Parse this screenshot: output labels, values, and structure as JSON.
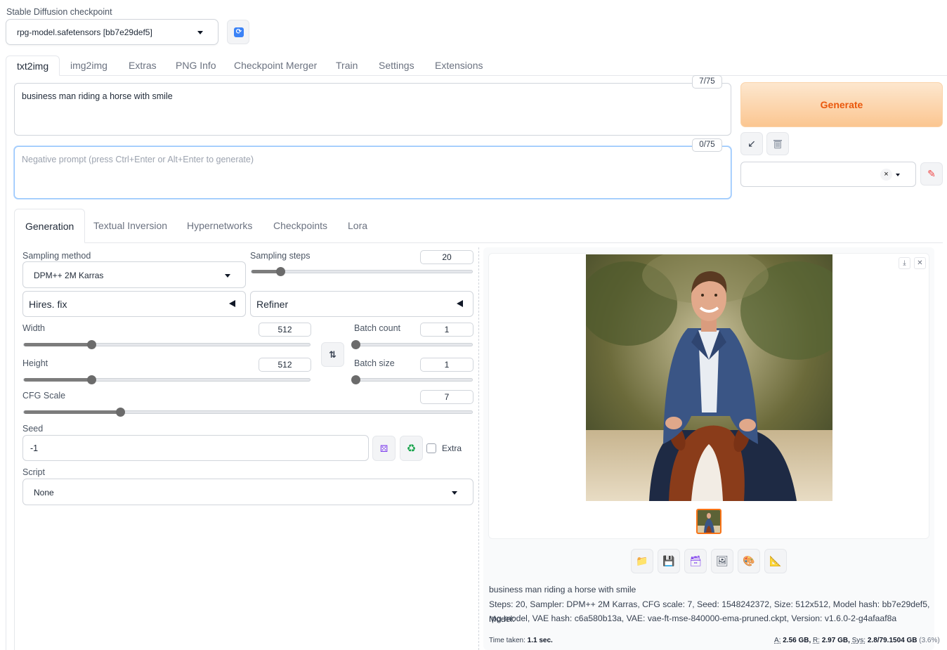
{
  "checkpoint": {
    "label": "Stable Diffusion checkpoint",
    "value": "rpg-model.safetensors [bb7e29def5]",
    "refresh_icon": "refresh-icon"
  },
  "tabs": [
    {
      "label": "txt2img",
      "active": true
    },
    {
      "label": "img2img"
    },
    {
      "label": "Extras"
    },
    {
      "label": "PNG Info"
    },
    {
      "label": "Checkpoint Merger"
    },
    {
      "label": "Train"
    },
    {
      "label": "Settings"
    },
    {
      "label": "Extensions"
    }
  ],
  "prompt": {
    "value": "business man riding a horse with smile",
    "counter": "7/75"
  },
  "negative_prompt": {
    "placeholder": "Negative prompt (press Ctrl+Enter or Alt+Enter to generate)",
    "counter": "0/75"
  },
  "generate": {
    "label": "Generate",
    "color": "#ea580c"
  },
  "actions": {
    "read_params_icon": "arrow-down-left-icon",
    "clear_icon": "trash-icon",
    "edit_style_icon": "pencil-icon",
    "clear_style_label": "×"
  },
  "subtabs": [
    {
      "label": "Generation",
      "active": true
    },
    {
      "label": "Textual Inversion"
    },
    {
      "label": "Hypernetworks"
    },
    {
      "label": "Checkpoints"
    },
    {
      "label": "Lora"
    }
  ],
  "generation": {
    "sampling_method": {
      "label": "Sampling method",
      "value": "DPM++ 2M Karras"
    },
    "sampling_steps": {
      "label": "Sampling steps",
      "value": "20",
      "fraction": 0.13
    },
    "hires_fix": {
      "label": "Hires. fix"
    },
    "refiner": {
      "label": "Refiner"
    },
    "width": {
      "label": "Width",
      "value": "512",
      "fraction": 0.235
    },
    "height": {
      "label": "Height",
      "value": "512",
      "fraction": 0.235
    },
    "batch_count": {
      "label": "Batch count",
      "value": "1",
      "fraction": 0.0
    },
    "batch_size": {
      "label": "Batch size",
      "value": "1",
      "fraction": 0.0
    },
    "swap_label": "⇅",
    "cfg_scale": {
      "label": "CFG Scale",
      "value": "7",
      "fraction": 0.214
    },
    "seed": {
      "label": "Seed",
      "value": "-1",
      "random_icon": "dice-icon",
      "reuse_icon": "recycle-icon"
    },
    "extra": {
      "label": "Extra",
      "checked": false
    },
    "script": {
      "label": "Script",
      "value": "None"
    }
  },
  "output": {
    "prompt_text": "business man riding a horse with smile",
    "params_line1": "Steps: 20, Sampler: DPM++ 2M Karras, CFG scale: 7, Seed: 1548242372, Size: 512x512, Model hash: bb7e29def5, Model:",
    "params_line2": "rpg-model, VAE hash: c6a580b13a, VAE: vae-ft-mse-840000-ema-pruned.ckpt, Version: v1.6.0-2-g4afaaf8a",
    "time_label": "Time taken:",
    "time_value": "1.1 sec.",
    "mem_a_label": "A:",
    "mem_a": "2.56 GB,",
    "mem_r_label": "R:",
    "mem_r": "2.97 GB,",
    "mem_sys_label": "Sys:",
    "mem_sys": "2.8/79.1504 GB",
    "mem_pct": "(3.6%)",
    "tools": [
      "folder-icon",
      "save-icon",
      "zip-icon",
      "send-to-img2img-icon",
      "send-to-inpaint-icon",
      "send-to-extras-icon"
    ],
    "download_icon": "download-icon",
    "close_icon": "close-icon"
  }
}
